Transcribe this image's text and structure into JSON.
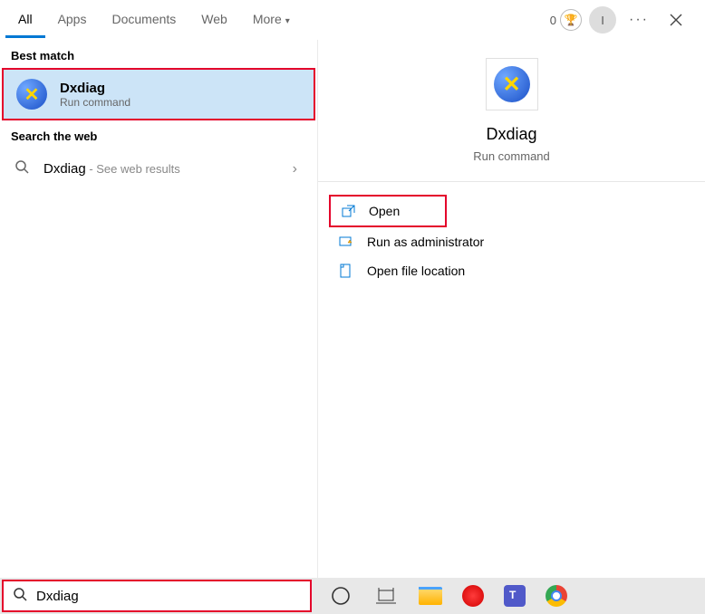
{
  "tabs": {
    "all": "All",
    "apps": "Apps",
    "documents": "Documents",
    "web": "Web",
    "more": "More"
  },
  "points": "0",
  "avatar_initial": "I",
  "left": {
    "best_match_label": "Best match",
    "result": {
      "title": "Dxdiag",
      "subtitle": "Run command"
    },
    "search_web_label": "Search the web",
    "web_result": {
      "term": "Dxdiag",
      "suffix": " - See web results"
    }
  },
  "right": {
    "title": "Dxdiag",
    "subtitle": "Run command",
    "actions": {
      "open": "Open",
      "run_admin": "Run as administrator",
      "open_location": "Open file location"
    }
  },
  "search": {
    "value": "Dxdiag"
  }
}
